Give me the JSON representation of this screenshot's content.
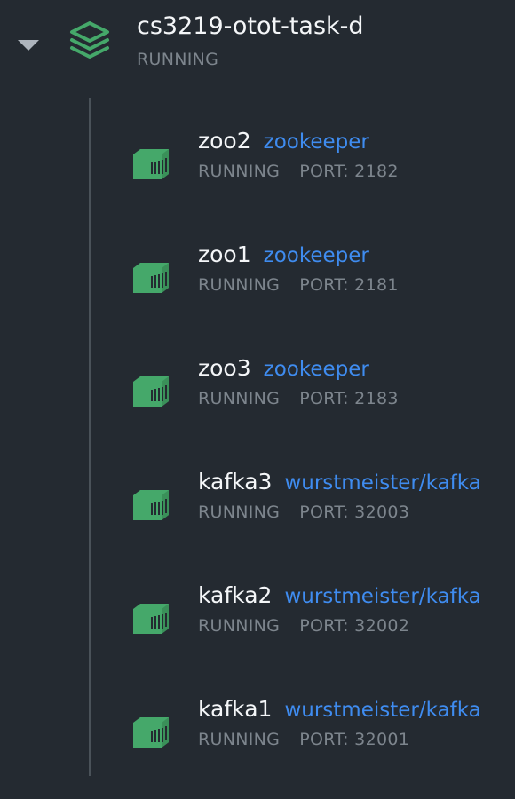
{
  "project": {
    "name": "cs3219-otot-task-d",
    "status": "RUNNING",
    "icon": "stack-icon",
    "expanded": true
  },
  "containers": [
    {
      "name": "zoo2",
      "image": "zookeeper",
      "status": "RUNNING",
      "port": "PORT: 2182"
    },
    {
      "name": "zoo1",
      "image": "zookeeper",
      "status": "RUNNING",
      "port": "PORT: 2181"
    },
    {
      "name": "zoo3",
      "image": "zookeeper",
      "status": "RUNNING",
      "port": "PORT: 2183"
    },
    {
      "name": "kafka3",
      "image": "wurstmeister/kafka",
      "status": "RUNNING",
      "port": "PORT: 32003"
    },
    {
      "name": "kafka2",
      "image": "wurstmeister/kafka",
      "status": "RUNNING",
      "port": "PORT: 32002"
    },
    {
      "name": "kafka1",
      "image": "wurstmeister/kafka",
      "status": "RUNNING",
      "port": "PORT: 32001"
    }
  ],
  "colors": {
    "background": "#242a31",
    "running_green": "#45a86a",
    "link_blue": "#3f8cf0"
  }
}
